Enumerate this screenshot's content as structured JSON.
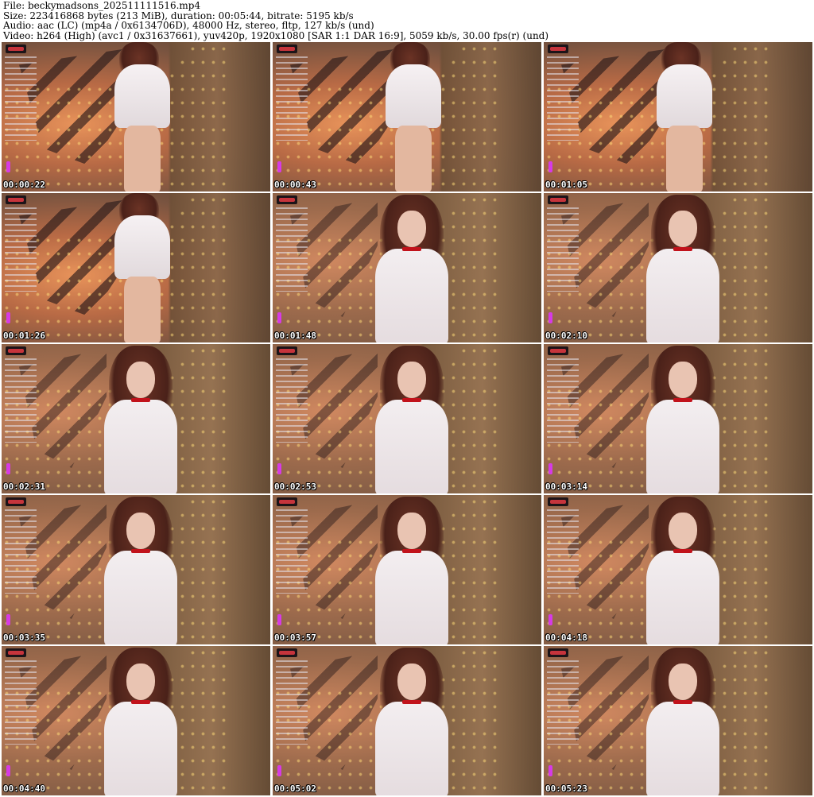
{
  "header": {
    "file": "File: beckymadsons_202511111516.mp4",
    "size": "Size: 223416868 bytes (213 MiB), duration: 00:05:44, bitrate: 5195 kb/s",
    "audio": "Audio: aac (LC) (mp4a / 0x6134706D), 48000 Hz, stereo, fltp, 127 kb/s (und)",
    "video": "Video: h264 (High) (avc1 / 0x31637661), yuv420p, 1920x1080 [SAR 1:1 DAR 16:9], 5059 kb/s, 30.00 fps(r) (und)"
  },
  "frames": [
    {
      "time": "00:00:22",
      "shot": "far"
    },
    {
      "time": "00:00:43",
      "shot": "far"
    },
    {
      "time": "00:01:05",
      "shot": "far"
    },
    {
      "time": "00:01:26",
      "shot": "far"
    },
    {
      "time": "00:01:48",
      "shot": "close"
    },
    {
      "time": "00:02:10",
      "shot": "close"
    },
    {
      "time": "00:02:31",
      "shot": "close"
    },
    {
      "time": "00:02:53",
      "shot": "close"
    },
    {
      "time": "00:03:14",
      "shot": "close"
    },
    {
      "time": "00:03:35",
      "shot": "close"
    },
    {
      "time": "00:03:57",
      "shot": "close"
    },
    {
      "time": "00:04:18",
      "shot": "close"
    },
    {
      "time": "00:04:40",
      "shot": "close"
    },
    {
      "time": "00:05:02",
      "shot": "close"
    },
    {
      "time": "00:05:23",
      "shot": "close"
    }
  ]
}
